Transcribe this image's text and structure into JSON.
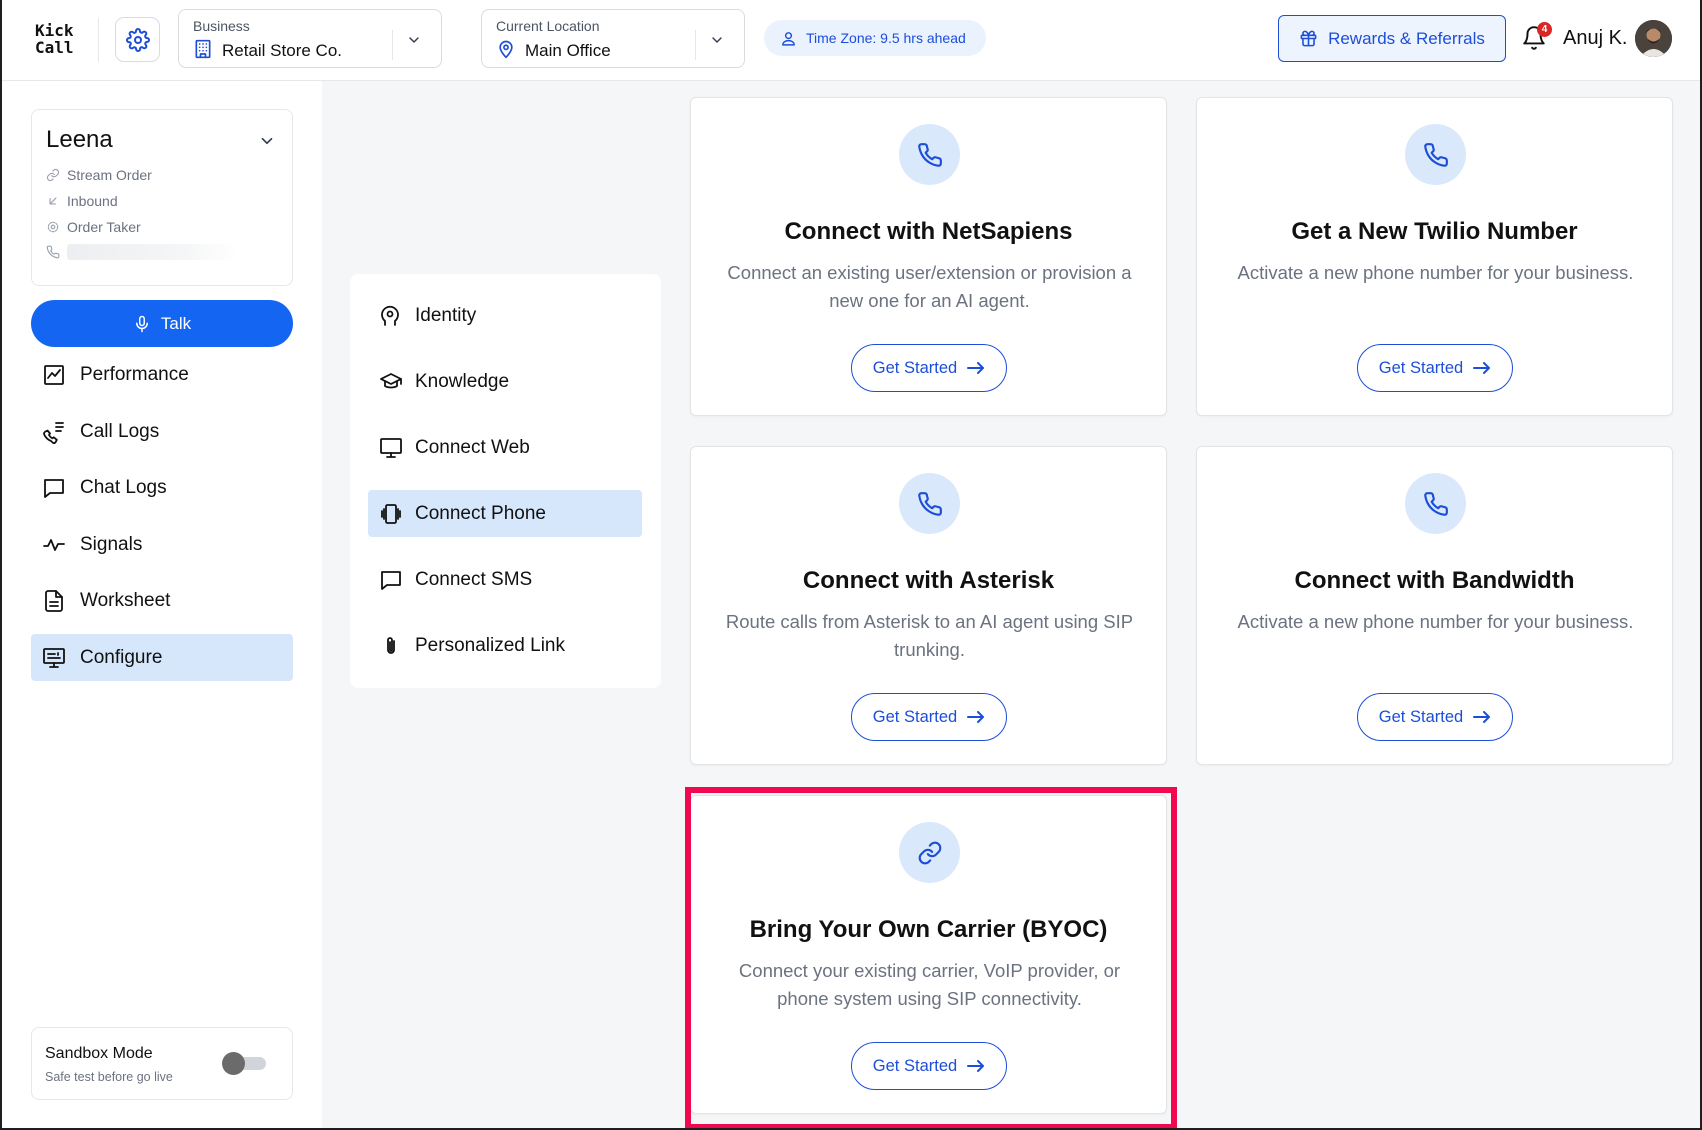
{
  "app": {
    "logo_line1": "Kick",
    "logo_line2": "Call",
    "accent_color": "#1466f2",
    "highlight_color": "#f0094f"
  },
  "header": {
    "settings_icon": "gear-icon",
    "business": {
      "caption": "Business",
      "value": "Retail Store Co."
    },
    "location": {
      "caption": "Current Location",
      "value": "Main Office"
    },
    "timezone": "Time Zone: 9.5 hrs ahead",
    "rewards_label": "Rewards & Referrals",
    "notification_count": "4",
    "user_name": "Anuj K."
  },
  "agent": {
    "name": "Leena",
    "use_case": "Stream Order",
    "direction": "Inbound",
    "role": "Order Taker"
  },
  "sidebar": {
    "talk_label": "Talk",
    "items": [
      {
        "label": "Performance",
        "icon": "chart-icon"
      },
      {
        "label": "Call Logs",
        "icon": "call-log-icon"
      },
      {
        "label": "Chat Logs",
        "icon": "chat-icon"
      },
      {
        "label": "Signals",
        "icon": "pulse-icon"
      },
      {
        "label": "Worksheet",
        "icon": "document-icon"
      },
      {
        "label": "Configure",
        "icon": "configure-icon",
        "active": true
      }
    ],
    "sandbox": {
      "title": "Sandbox Mode",
      "subtitle": "Safe test before go live",
      "enabled": false
    }
  },
  "submenu": {
    "items": [
      {
        "label": "Identity",
        "icon": "head-icon"
      },
      {
        "label": "Knowledge",
        "icon": "graduation-cap-icon"
      },
      {
        "label": "Connect Web",
        "icon": "monitor-icon"
      },
      {
        "label": "Connect Phone",
        "icon": "vibrating-phone-icon",
        "active": true
      },
      {
        "label": "Connect SMS",
        "icon": "message-icon"
      },
      {
        "label": "Personalized Link",
        "icon": "paperclip-icon"
      }
    ]
  },
  "cards": [
    {
      "title": "Connect with NetSapiens",
      "description": "Connect an existing user/extension or provision a new one for an AI agent.",
      "button": "Get Started",
      "icon": "phone-icon"
    },
    {
      "title": "Get a New Twilio Number",
      "description": "Activate a new phone number for your business.",
      "button": "Get Started",
      "icon": "phone-icon"
    },
    {
      "title": "Connect with Asterisk",
      "description": "Route calls from Asterisk to an AI agent using SIP trunking.",
      "button": "Get Started",
      "icon": "phone-icon"
    },
    {
      "title": "Connect with Bandwidth",
      "description": "Activate a new phone number for your business.",
      "button": "Get Started",
      "icon": "phone-icon"
    },
    {
      "title": "Bring Your Own Carrier (BYOC)",
      "description": "Connect your existing carrier, VoIP provider, or phone system using SIP connectivity.",
      "button": "Get Started",
      "icon": "link-icon",
      "highlighted": true
    }
  ]
}
